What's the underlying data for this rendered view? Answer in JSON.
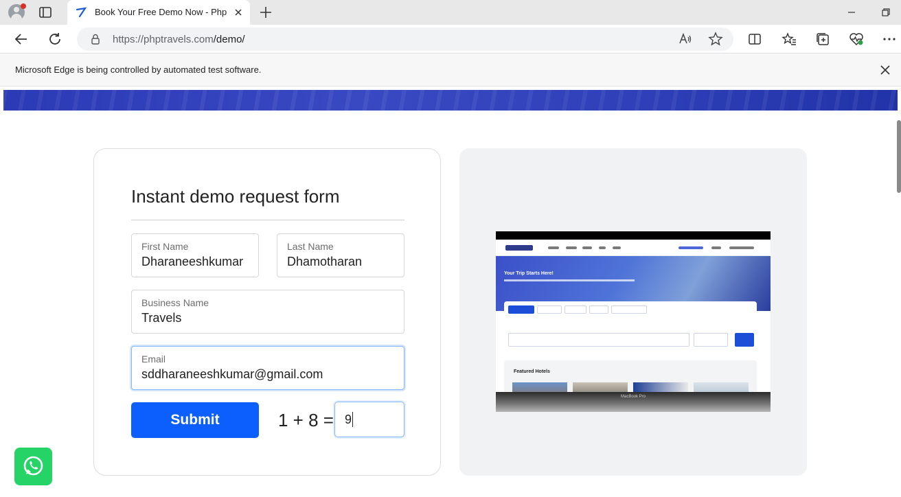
{
  "browser": {
    "tab_title": "Book Your Free Demo Now - Php",
    "url_host": "https://phptravels.com",
    "url_path": "/demo/",
    "infobar_text": "Microsoft Edge is being controlled by automated test software."
  },
  "form": {
    "title": "Instant demo request form",
    "first_name": {
      "label": "First Name",
      "value": "Dharaneeshkumar"
    },
    "last_name": {
      "label": "Last Name",
      "value": "Dhamotharan"
    },
    "business_name": {
      "label": "Business Name",
      "value": "Travels"
    },
    "email": {
      "label": "Email",
      "value": "sddharaneeshkumar@gmail.com"
    },
    "submit_label": "Submit",
    "captcha_question": "1 + 8 =",
    "captcha_answer": "9"
  },
  "preview": {
    "hero_title": "Your Trip Starts Here!",
    "featured_title": "Featured Hotels",
    "laptop_label": "MacBook Pro"
  },
  "colors": {
    "primary": "#0d5ffd",
    "whatsapp": "#25d366",
    "banner": "#2f40b8"
  }
}
